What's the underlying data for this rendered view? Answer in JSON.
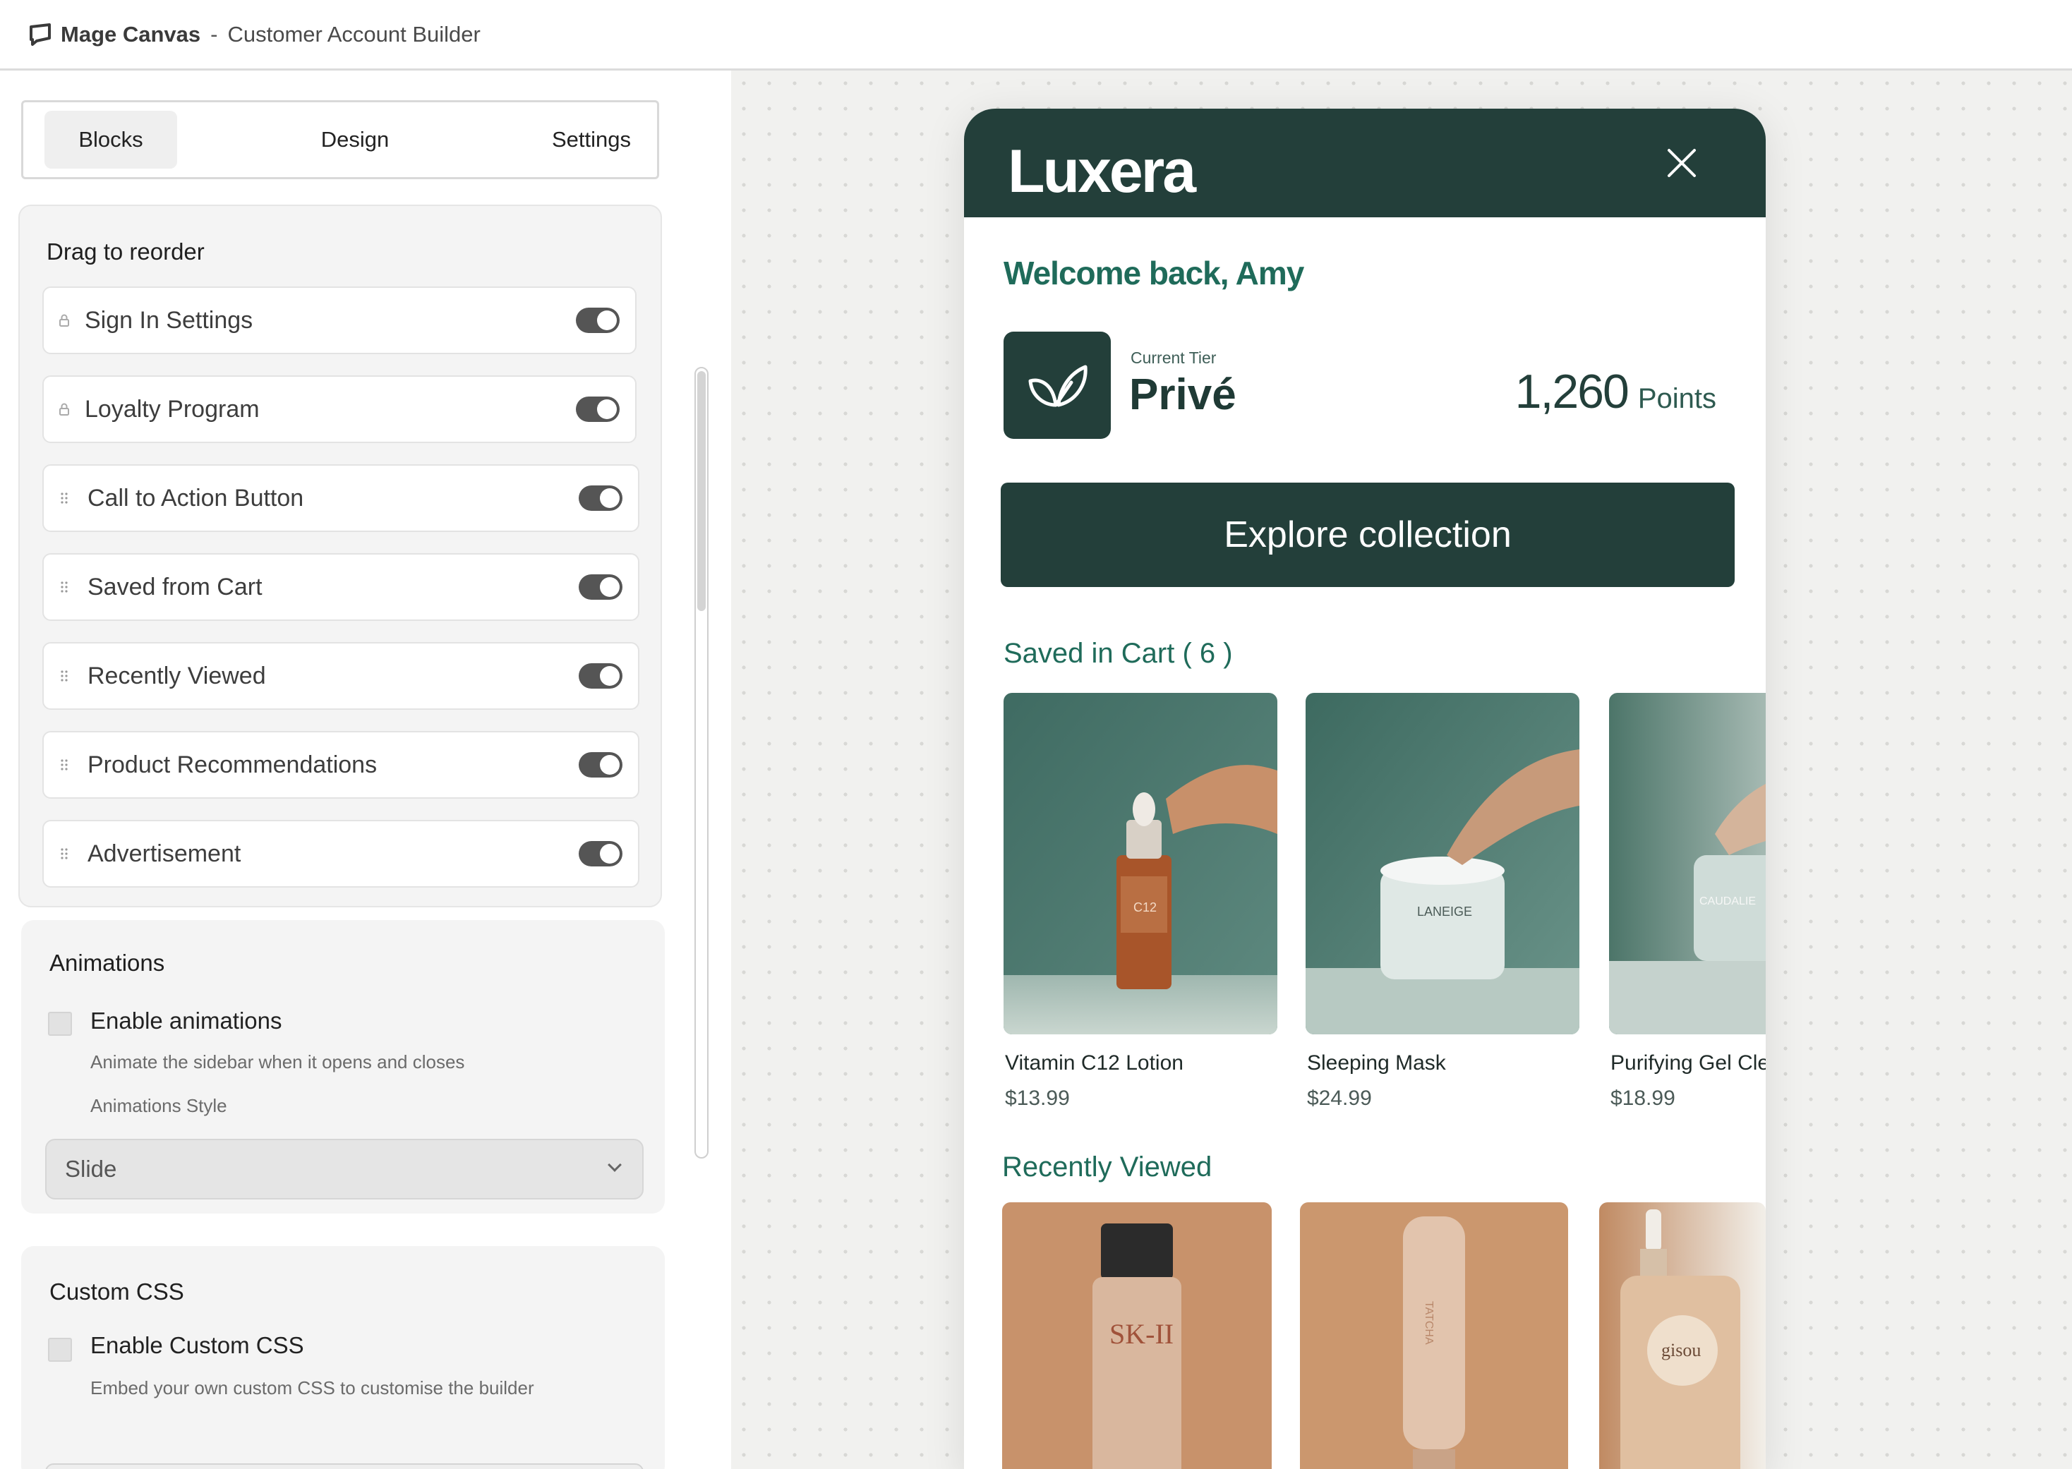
{
  "app": {
    "name": "Mage Canvas",
    "separator": "-",
    "page": "Customer Account Builder"
  },
  "tabs": [
    {
      "label": "Blocks",
      "active": true
    },
    {
      "label": "Design",
      "active": false
    },
    {
      "label": "Settings",
      "active": false
    }
  ],
  "blocks": {
    "title": "Drag to reorder",
    "items": [
      {
        "label": "Sign In Settings",
        "icon": "lock-icon",
        "enabled": true
      },
      {
        "label": "Loyalty Program",
        "icon": "lock-icon",
        "enabled": true
      },
      {
        "label": "Call to Action Button",
        "icon": "drag-handle-icon",
        "enabled": true
      },
      {
        "label": "Saved from Cart",
        "icon": "drag-handle-icon",
        "enabled": true
      },
      {
        "label": "Recently Viewed",
        "icon": "drag-handle-icon",
        "enabled": true
      },
      {
        "label": "Product Recommendations",
        "icon": "drag-handle-icon",
        "enabled": true
      },
      {
        "label": "Advertisement",
        "icon": "drag-handle-icon",
        "enabled": true
      }
    ]
  },
  "animations": {
    "title": "Animations",
    "checkbox_label": "Enable animations",
    "checked": false,
    "description": "Animate the sidebar when it opens and closes",
    "style_label": "Animations Style",
    "style_value": "Slide"
  },
  "custom_css": {
    "title": "Custom CSS",
    "checkbox_label": "Enable Custom CSS",
    "checked": false,
    "description": "Embed your own custom CSS to customise the builder"
  },
  "preview": {
    "brand": "Luxera",
    "welcome": "Welcome back, Amy",
    "tier_label": "Current Tier",
    "tier_name": "Privé",
    "points_value": "1,260",
    "points_unit": "Points",
    "cta_label": "Explore collection",
    "saved_title": "Saved in Cart",
    "saved_count": "( 6 )",
    "saved_items": [
      {
        "name": "Vitamin C12 Lotion",
        "price": "$13.99",
        "product_label": "C12"
      },
      {
        "name": "Sleeping Mask",
        "price": "$24.99",
        "product_label": "LANEIGE"
      },
      {
        "name": "Purifying Gel Clea",
        "price": "$18.99",
        "product_label": "CAUDALIE"
      }
    ],
    "recent_title": "Recently Viewed",
    "recent_items": [
      {
        "product_label": "SK-II"
      },
      {
        "product_label": "TATCHA"
      },
      {
        "product_label": "gisou"
      }
    ]
  },
  "colors": {
    "brand_green": "#233f3a",
    "accent_green": "#1f6b5a",
    "toggle_on": "#555555"
  }
}
